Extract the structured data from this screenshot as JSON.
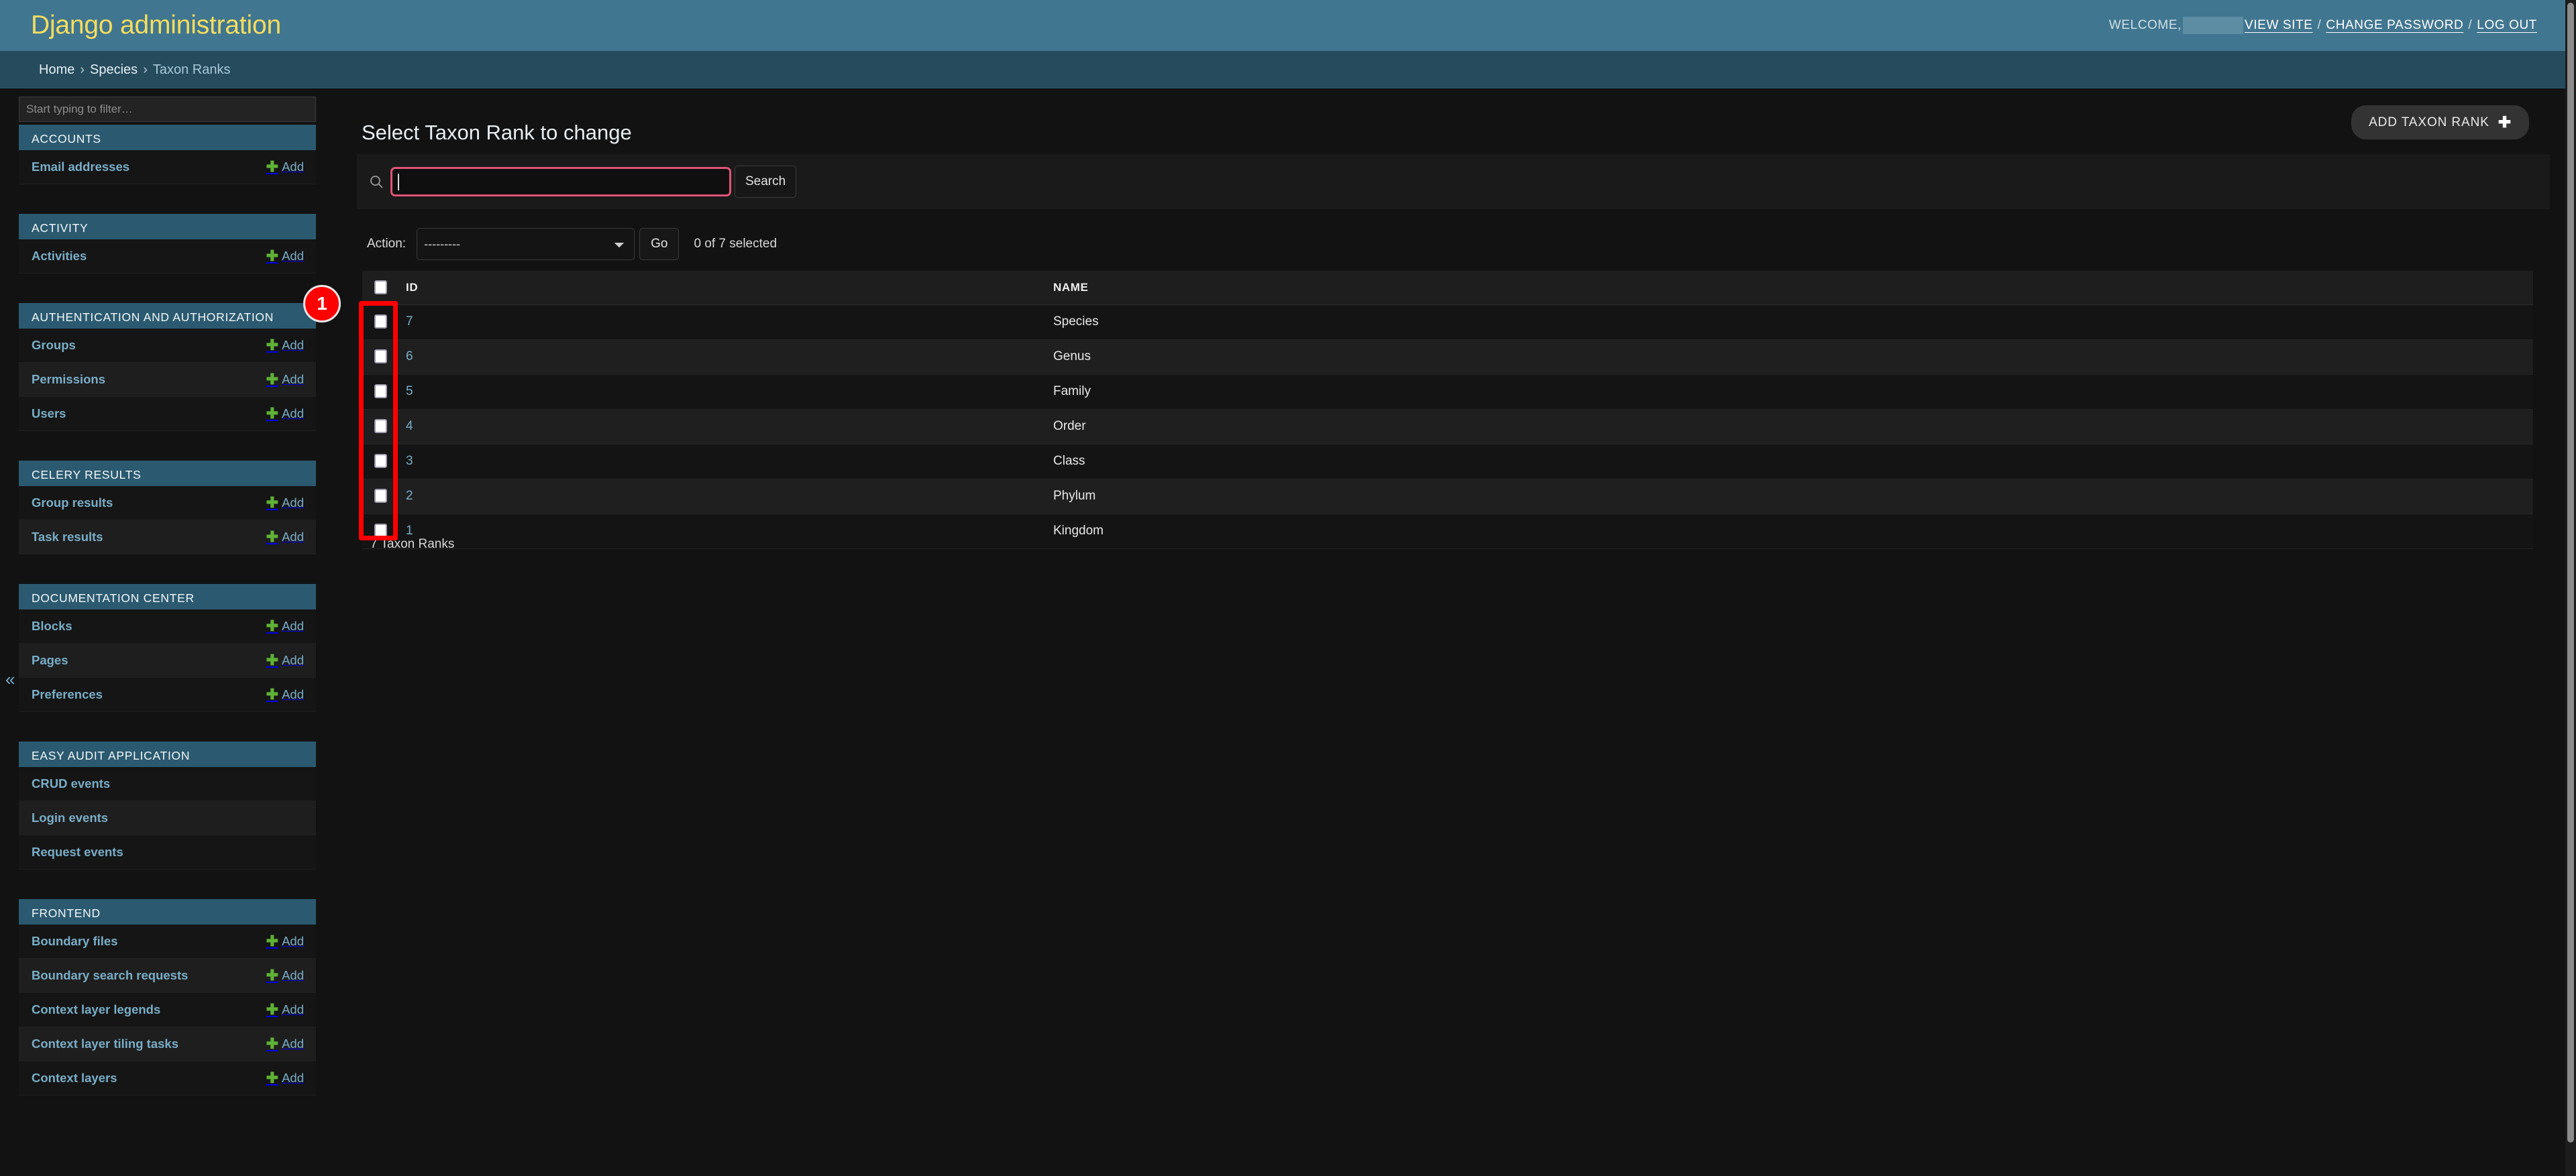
{
  "header": {
    "site_title": "Django administration",
    "welcome_text": "WELCOME,",
    "username_redacted": "",
    "view_site": "VIEW SITE",
    "change_password": "CHANGE PASSWORD",
    "log_out": "LOG OUT",
    "separator": "/"
  },
  "breadcrumbs": {
    "home": "Home",
    "app": "Species",
    "current": "Taxon Ranks",
    "separator": "›"
  },
  "sidebar": {
    "filter_placeholder": "Start typing to filter…",
    "filter_value": "",
    "toggle_icon": "«",
    "add_label": "Add",
    "apps": [
      {
        "caption": "ACCOUNTS",
        "models": [
          {
            "label": "Email addresses",
            "has_add": true
          }
        ]
      },
      {
        "caption": "ACTIVITY",
        "models": [
          {
            "label": "Activities",
            "has_add": true
          }
        ]
      },
      {
        "caption": "AUTHENTICATION AND AUTHORIZATION",
        "models": [
          {
            "label": "Groups",
            "has_add": true
          },
          {
            "label": "Permissions",
            "has_add": true
          },
          {
            "label": "Users",
            "has_add": true
          }
        ]
      },
      {
        "caption": "CELERY RESULTS",
        "models": [
          {
            "label": "Group results",
            "has_add": true
          },
          {
            "label": "Task results",
            "has_add": true
          }
        ]
      },
      {
        "caption": "DOCUMENTATION CENTER",
        "models": [
          {
            "label": "Blocks",
            "has_add": true
          },
          {
            "label": "Pages",
            "has_add": true
          },
          {
            "label": "Preferences",
            "has_add": true
          }
        ]
      },
      {
        "caption": "EASY AUDIT APPLICATION",
        "models": [
          {
            "label": "CRUD events",
            "has_add": false
          },
          {
            "label": "Login events",
            "has_add": false
          },
          {
            "label": "Request events",
            "has_add": false
          }
        ]
      },
      {
        "caption": "FRONTEND",
        "models": [
          {
            "label": "Boundary files",
            "has_add": true
          },
          {
            "label": "Boundary search requests",
            "has_add": true
          },
          {
            "label": "Context layer legends",
            "has_add": true
          },
          {
            "label": "Context layer tiling tasks",
            "has_add": true
          },
          {
            "label": "Context layers",
            "has_add": true
          }
        ]
      }
    ]
  },
  "main": {
    "page_title": "Select Taxon Rank to change",
    "add_button_label": "ADD TAXON RANK",
    "search": {
      "value": "",
      "placeholder": "",
      "submit_label": "Search",
      "icon": "search-icon"
    },
    "actions": {
      "label": "Action:",
      "selected": "---------",
      "options": [
        "---------"
      ],
      "go_label": "Go",
      "counter": "0 of 7 selected"
    },
    "table": {
      "columns": [
        "ID",
        "NAME"
      ],
      "rows": [
        {
          "id": "7",
          "name": "Species"
        },
        {
          "id": "6",
          "name": "Genus"
        },
        {
          "id": "5",
          "name": "Family"
        },
        {
          "id": "4",
          "name": "Order"
        },
        {
          "id": "3",
          "name": "Class"
        },
        {
          "id": "2",
          "name": "Phylum"
        },
        {
          "id": "1",
          "name": "Kingdom"
        }
      ]
    },
    "result_count": "7 Taxon Ranks"
  },
  "annotations": {
    "badge_number": "1",
    "badge_color": "#ff0000",
    "rect_color": "#ff0000"
  },
  "colors": {
    "header_bg": "#417690",
    "breadcrumb_bg": "#264b5d",
    "brand_text": "#f5dd5d",
    "link": "#79aec8",
    "add_plus": "#5fb236",
    "focus_ring": "#e0537a",
    "page_bg": "#121212"
  }
}
